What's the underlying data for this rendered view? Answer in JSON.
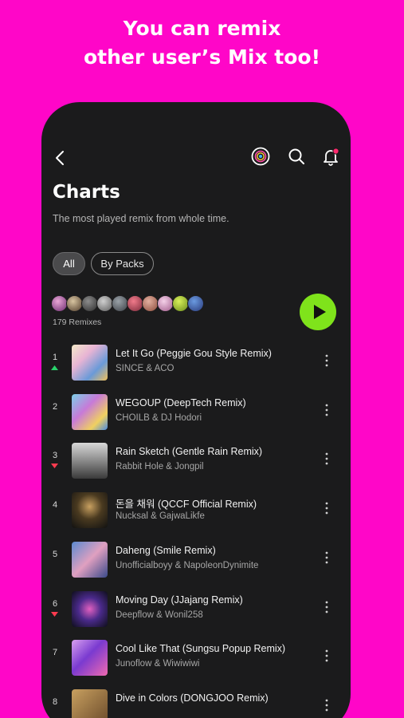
{
  "promo": {
    "line1": "You can remix",
    "line2": "other user’s Mix too!"
  },
  "header": {
    "title": "Charts",
    "subtitle": "The most played remix from whole time.",
    "icons": [
      "back-icon",
      "disc-icon",
      "search-icon",
      "bell-icon"
    ],
    "notification_dot_color": "#ff2a6d"
  },
  "filters": {
    "all_label": "All",
    "packs_label": "By Packs",
    "selected": "All"
  },
  "summary": {
    "remix_count": "179 Remixes",
    "play_color": "#7fe31b"
  },
  "tracks": [
    {
      "rank": "1",
      "trend": "up",
      "title": "Let It Go (Peggie Gou Style Remix)",
      "artist": "SINCE & ACO"
    },
    {
      "rank": "2",
      "trend": "none",
      "title": "WEGOUP (DeepTech Remix)",
      "artist": "CHOILB & DJ Hodori"
    },
    {
      "rank": "3",
      "trend": "down",
      "title": "Rain Sketch (Gentle Rain Remix)",
      "artist": "Rabbit Hole & Jongpil"
    },
    {
      "rank": "4",
      "trend": "none",
      "title": "돈을 채워 (QCCF Official Remix)",
      "artist": "Nucksal & GajwaLikfe"
    },
    {
      "rank": "5",
      "trend": "none",
      "title": "Daheng (Smile Remix)",
      "artist": "Unofficialboyy & NapoleonDynimite"
    },
    {
      "rank": "6",
      "trend": "down",
      "title": "Moving Day (JJajang Remix)",
      "artist": "Deepflow & Wonil258"
    },
    {
      "rank": "7",
      "trend": "none",
      "title": "Cool Like That (Sungsu Popup Remix)",
      "artist": "Junoflow & Wiwiwiwi"
    },
    {
      "rank": "8",
      "trend": "none",
      "title": "Dive in Colors (DONGJOO Remix)",
      "artist": ""
    }
  ],
  "colors": {
    "background": "#ff06c8",
    "phone": "#1b1b1c",
    "trend_up": "#29d36b",
    "trend_down": "#ff3b4f"
  }
}
